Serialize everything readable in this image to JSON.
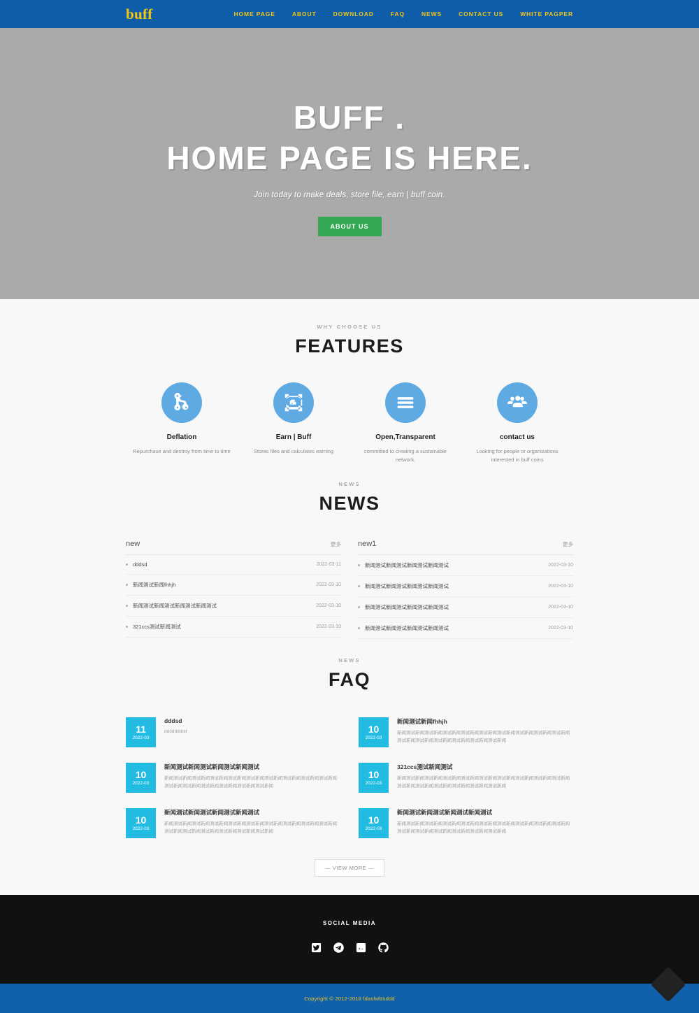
{
  "header": {
    "brand": "buff",
    "nav": [
      {
        "label": "HOME PAGE"
      },
      {
        "label": "ABOUT"
      },
      {
        "label": "DOWNLOAD"
      },
      {
        "label": "FAQ"
      },
      {
        "label": "NEWS"
      },
      {
        "label": "CONTACT US"
      },
      {
        "label": "WHITE PAGPER"
      }
    ]
  },
  "hero": {
    "title_line1": "BUFF .",
    "title_line2": "HOME PAGE IS HERE.",
    "subtitle": "Join today to make deals, store file, earn | buff coin.",
    "cta_label": "ABOUT US"
  },
  "features": {
    "kicker": "WHY CHOOSE US",
    "title": "FEATURES",
    "items": [
      {
        "icon": "code-branch-icon",
        "name": "Deflation",
        "desc": "Repurchase and destroy from time to time"
      },
      {
        "icon": "vector-square-icon",
        "name": "Earn | Buff",
        "desc": "Stores files and calculates earning"
      },
      {
        "icon": "bars-icon",
        "name": "Open,Transparent",
        "desc": "committed to creating a sustainable network."
      },
      {
        "icon": "users-icon",
        "name": "contact us",
        "desc": "Looking for people or organizations interested in buff coins"
      }
    ]
  },
  "news": {
    "kicker": "NEWS",
    "title": "NEWS",
    "columns": [
      {
        "title": "new",
        "more_label": "更多",
        "items": [
          {
            "title": "dddsd",
            "date": "2022-03-11"
          },
          {
            "title": "新闻测试新闻fhhjh",
            "date": "2022-03-10"
          },
          {
            "title": "新闻测试新闻测试新闻测试新闻测试",
            "date": "2022-03-10"
          },
          {
            "title": "321ccs测试新闻测试",
            "date": "2022-03-10"
          }
        ]
      },
      {
        "title": "new1",
        "more_label": "更多",
        "items": [
          {
            "title": "新闻测试新闻测试新闻测试新闻测试",
            "date": "2022-03-10"
          },
          {
            "title": "新闻测试新闻测试新闻测试新闻测试",
            "date": "2022-03-10"
          },
          {
            "title": "新闻测试新闻测试新闻测试新闻测试",
            "date": "2022-03-10"
          },
          {
            "title": "新闻测试新闻测试新闻测试新闻测试",
            "date": "2022-03-10"
          }
        ]
      }
    ]
  },
  "faq": {
    "kicker": "NEWS",
    "title": "FAQ",
    "items": [
      {
        "day": "11",
        "month": "2022-03",
        "title": "dddsd",
        "text": "ddddddddd"
      },
      {
        "day": "10",
        "month": "2022-03",
        "title": "新闻测试新闻fhhjh",
        "text": "新闻测试新闻测试新闻测试新闻测试新闻测试新闻测试新闻测试新闻测试新闻测试新闻测试新闻测试新闻测试新闻测试新闻测试新闻测试新闻"
      },
      {
        "day": "10",
        "month": "2022-03",
        "title": "新闻测试新闻测试新闻测试新闻测试",
        "text": "新闻测试新闻测试新闻测试新闻测试新闻测试新闻测试新闻测试新闻测试新闻测试新闻测试新闻测试新闻测试新闻测试新闻测试新闻测试新闻"
      },
      {
        "day": "10",
        "month": "2022-03",
        "title": "321ccs测试新闻测试",
        "text": "新闻测试新闻测试新闻测试新闻测试新闻测试新闻测试新闻测试新闻测试新闻测试新闻测试新闻测试新闻测试新闻测试新闻测试新闻测试新闻"
      },
      {
        "day": "10",
        "month": "2022-03",
        "title": "新闻测试新闻测试新闻测试新闻测试",
        "text": "新闻测试新闻测试新闻测试新闻测试新闻测试新闻测试新闻测试新闻测试新闻测试新闻测试新闻测试新闻测试新闻测试新闻测试新闻测试新闻"
      },
      {
        "day": "10",
        "month": "2022-03",
        "title": "新闻测试新闻测试新闻测试新闻测试",
        "text": "新闻测试新闻测试新闻测试新闻测试新闻测试新闻测试新闻测试新闻测试新闻测试新闻测试新闻测试新闻测试新闻测试新闻测试新闻测试新闻"
      }
    ],
    "view_more_label": "— VIEW MORE —"
  },
  "footer": {
    "social_label": "SOCIAL MEDIA",
    "social": [
      {
        "icon": "twitter-icon"
      },
      {
        "icon": "telegram-icon"
      },
      {
        "icon": "discord-icon"
      },
      {
        "icon": "github-icon"
      }
    ],
    "copyright": "Copyright © 2012-2018 fdasfafdsddd"
  },
  "colors": {
    "brand_blue": "#0f5ca8",
    "brand_yellow": "#f2c714",
    "hero_gray": "#aaaaaa",
    "cta_green": "#34a853",
    "feature_blue": "#5faae3",
    "faq_cyan": "#22bce2",
    "footer_black": "#111111"
  }
}
